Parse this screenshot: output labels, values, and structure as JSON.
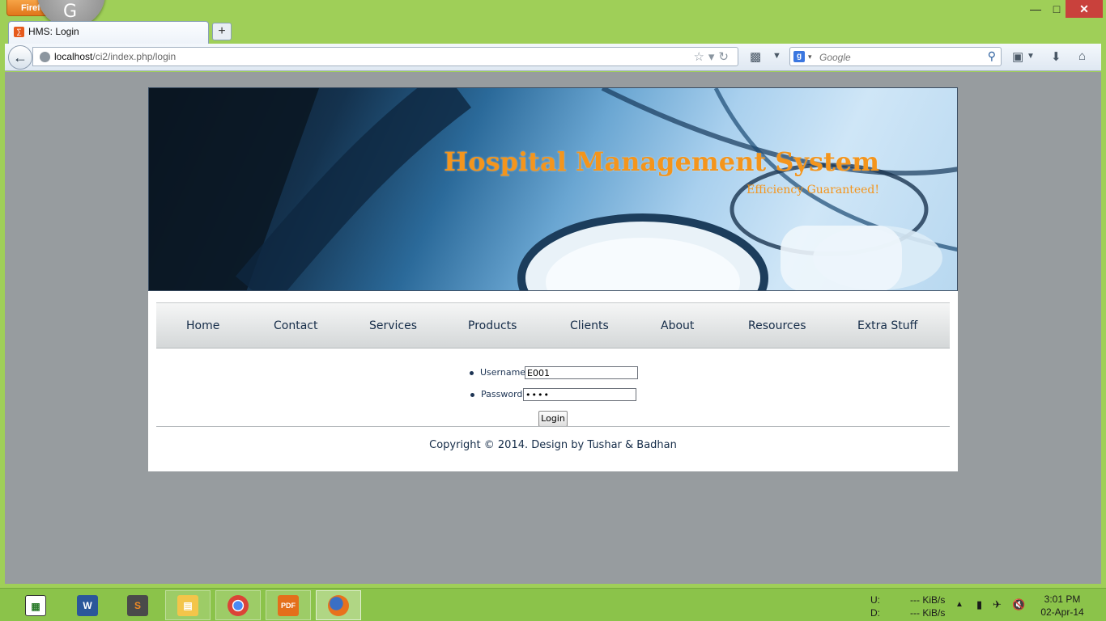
{
  "browser": {
    "menu_button": "Firefox",
    "tab_title": "HMS: Login",
    "new_tab": "+",
    "url_host": "localhost",
    "url_path": "/ci2/index.php/login",
    "search_placeholder": "Google"
  },
  "site": {
    "title": "Hospital Management System",
    "subtitle": "Efficiency Guaranteed!",
    "menu": [
      "Home",
      "Contact",
      "Services",
      "Products",
      "Clients",
      "About",
      "Resources",
      "Extra Stuff"
    ],
    "login": {
      "username_label": "Username:",
      "username_value": "E001",
      "password_label": "Password:",
      "password_value": "••••",
      "submit_label": "Login"
    },
    "copyright": "Copyright © 2014. Design by Tushar & Badhan"
  },
  "taskbar": {
    "upload_label": "U:",
    "download_label": "D:",
    "upload_rate": "--- KiB/s",
    "download_rate": "--- KiB/s",
    "time": "3:01 PM",
    "date": "02-Apr-14"
  },
  "colors": {
    "accent_orange": "#f4951c",
    "nav_text": "#152c48",
    "page_bg": "#979c9f",
    "desktop_green": "#9fcf58"
  }
}
